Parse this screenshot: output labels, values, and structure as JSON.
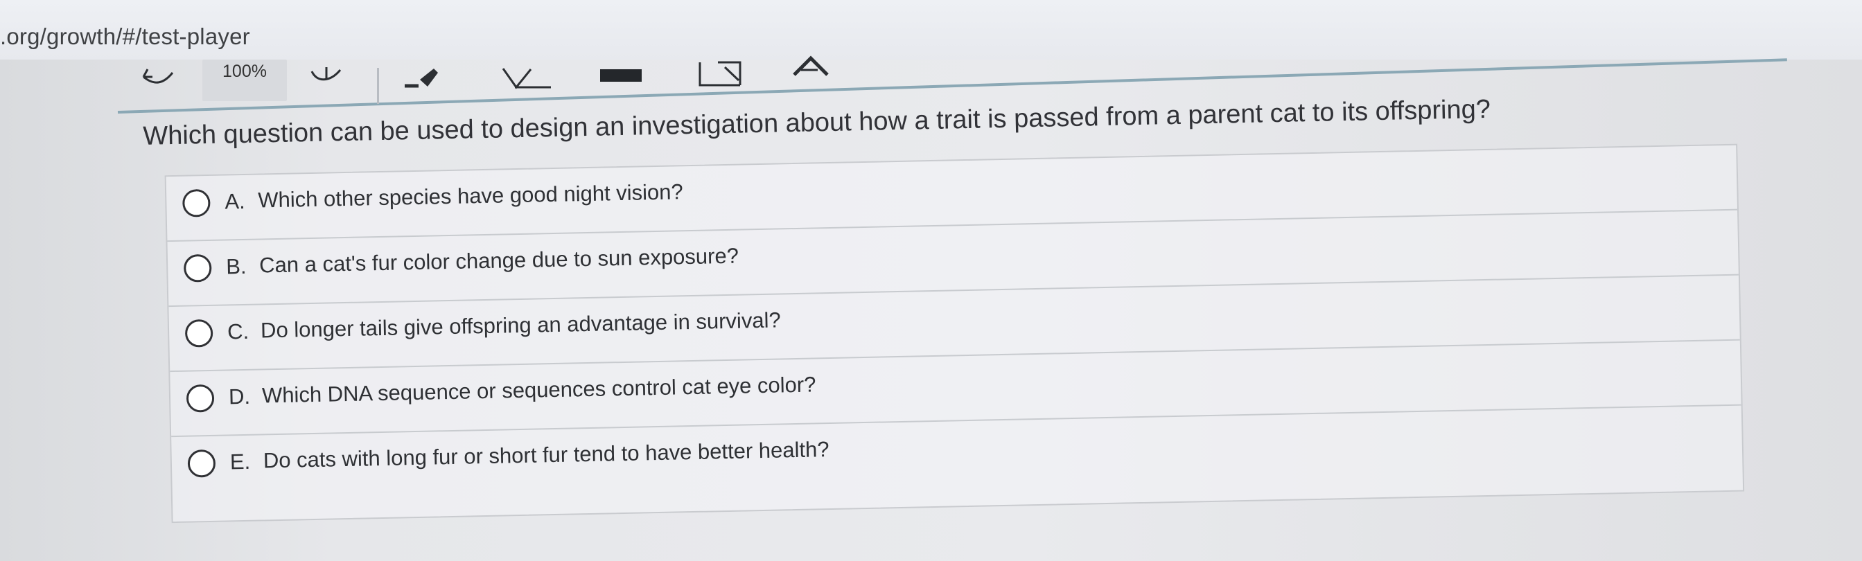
{
  "browser": {
    "url": ".org/growth/#/test-player"
  },
  "toolbar": {
    "zoom_label": "100%",
    "icons": [
      "left-arrow-icon",
      "down-arrow-icon",
      "highlighter-icon",
      "checkmark-icon",
      "line-icon",
      "box-icon",
      "triangle-icon"
    ]
  },
  "question": {
    "text": "Which question can be used to design an investigation about how a trait is passed from a parent cat to its offspring?",
    "options": [
      {
        "letter": "A.",
        "text": "Which other species have good night vision?"
      },
      {
        "letter": "B.",
        "text": "Can a cat's fur color change due to sun exposure?"
      },
      {
        "letter": "C.",
        "text": "Do longer tails give offspring an advantage in survival?"
      },
      {
        "letter": "D.",
        "text": "Which DNA sequence or sequences control cat eye color?"
      },
      {
        "letter": "E.",
        "text": "Do cats with long fur or short fur tend to have better health?"
      }
    ]
  }
}
